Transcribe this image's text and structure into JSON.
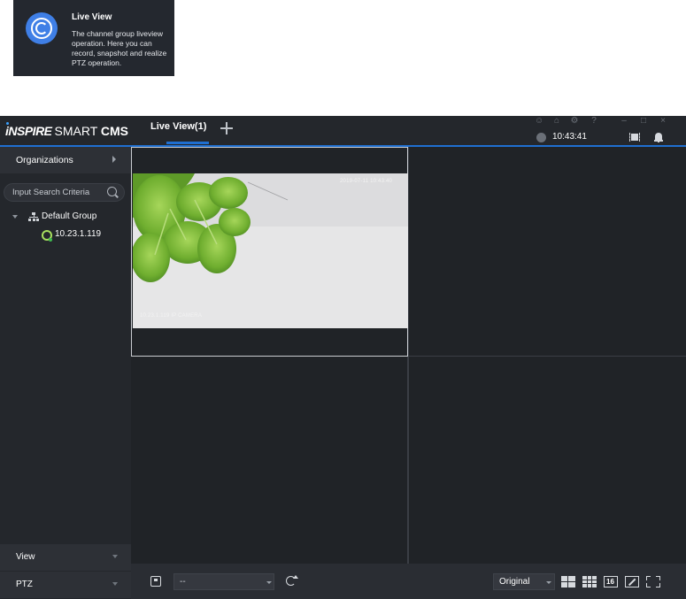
{
  "tooltip": {
    "icon": "live-view-circle-icon",
    "title": "Live View",
    "description": "The channel group liveview operation. Here you can record, snapshot and realize PTZ operation."
  },
  "app": {
    "logo": {
      "part1": "iNSPIRE",
      "part2": "SMART",
      "part3": "CMS"
    },
    "tabs": [
      {
        "label": "Live View(1)",
        "active": true
      }
    ],
    "add_tab_icon": "plus-icon",
    "top_icons": [
      "user-icon",
      "lock-icon",
      "settings-gear-icon",
      "help-icon",
      "minimize-icon",
      "maximize-icon",
      "close-icon"
    ],
    "clock": "10:43:41",
    "accent_color": "#1f6fd1"
  },
  "sidebar": {
    "organizations_label": "Organizations",
    "search_placeholder": "Input Search Criteria",
    "tree": {
      "group_label": "Default Group",
      "devices": [
        {
          "label": "10.23.1.119",
          "status": "online"
        }
      ]
    },
    "panels": [
      {
        "label": "View"
      },
      {
        "label": "PTZ"
      }
    ]
  },
  "grid": {
    "layout": "2x2",
    "selected_cell": 1,
    "cells": [
      {
        "has_video": true,
        "osd_top": "2019-07-11 10:43:40",
        "osd_bottom": "10.23.1.119 IP CAMERA"
      },
      {
        "has_video": false
      },
      {
        "has_video": false
      },
      {
        "has_video": false
      }
    ]
  },
  "toolbar": {
    "preset_value": "--",
    "aspect_value": "Original",
    "layout_16_label": "16"
  }
}
